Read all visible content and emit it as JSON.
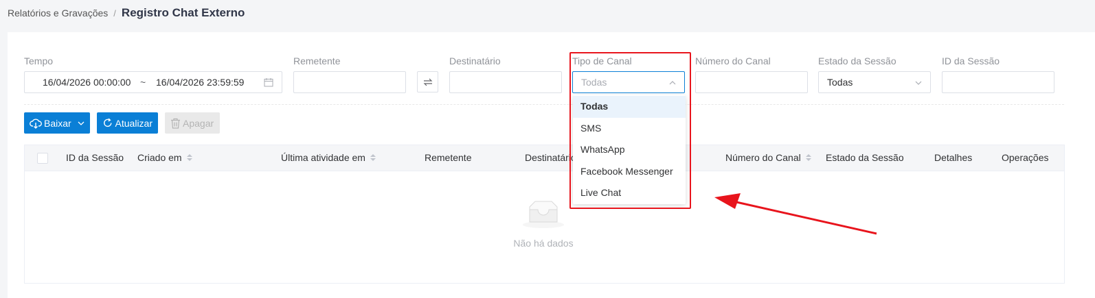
{
  "breadcrumb": {
    "parent": "Relatórios e Gravações",
    "separator": "/",
    "current": "Registro Chat Externo"
  },
  "filters": {
    "tempo": {
      "label": "Tempo",
      "start": "16/04/2026 00:00:00",
      "separator": "~",
      "end": "16/04/2026 23:59:59"
    },
    "remetente": {
      "label": "Remetente",
      "value": ""
    },
    "destinatario": {
      "label": "Destinatário",
      "value": ""
    },
    "tipo_canal": {
      "label": "Tipo de Canal",
      "placeholder": "Todas"
    },
    "numero_canal": {
      "label": "Número do Canal",
      "value": ""
    },
    "estado_sessao": {
      "label": "Estado da Sessão",
      "value": "Todas"
    },
    "id_sessao": {
      "label": "ID da Sessão",
      "value": ""
    }
  },
  "toolbar": {
    "download_label": "Baixar",
    "refresh_label": "Atualizar",
    "delete_label": "Apagar"
  },
  "table": {
    "columns": [
      "ID da Sessão",
      "Criado em",
      "Última atividade em",
      "Remetente",
      "Destinatário",
      "Número do Canal",
      "Estado da Sessão",
      "Detalhes",
      "Operações"
    ],
    "empty_text": "Não há dados"
  },
  "dropdown": {
    "options": [
      "Todas",
      "SMS",
      "WhatsApp",
      "Facebook Messenger",
      "Live Chat"
    ],
    "selected": "Todas"
  },
  "colors": {
    "primary": "#0a7fd6",
    "annotation": "#e8141c"
  },
  "icons": [
    "calendar-icon",
    "swap-icon",
    "chevron-up-icon",
    "chevron-down-icon",
    "cloud-download-icon",
    "refresh-icon",
    "trash-icon",
    "empty-inbox-icon",
    "sort-icon"
  ]
}
